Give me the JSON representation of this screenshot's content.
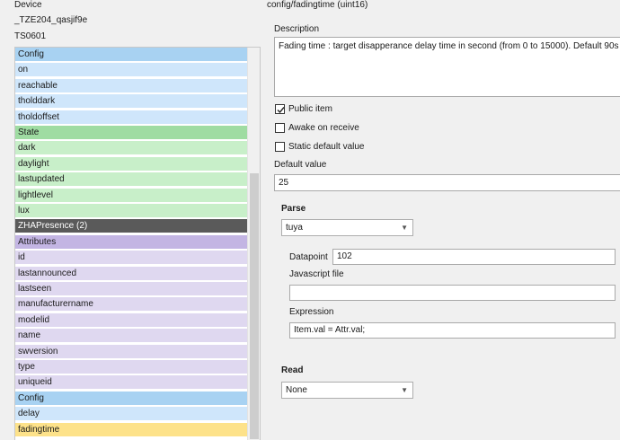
{
  "device": {
    "header_label": "Device",
    "model_id": "_TZE204_qasjif9e",
    "manufacturer": "TS0601"
  },
  "tree": {
    "rows": [
      {
        "label": "Config",
        "color": "#a8d2f2"
      },
      {
        "label": "on",
        "color": "#cfe6fb"
      },
      {
        "label": "reachable",
        "color": "#cfe6fb"
      },
      {
        "label": "tholddark",
        "color": "#cfe6fb"
      },
      {
        "label": "tholdoffset",
        "color": "#cfe6fb"
      },
      {
        "label": "State",
        "color": "#9fdca2"
      },
      {
        "label": "dark",
        "color": "#c8efc9"
      },
      {
        "label": "daylight",
        "color": "#c8efc9"
      },
      {
        "label": "lastupdated",
        "color": "#c8efc9"
      },
      {
        "label": "lightlevel",
        "color": "#c8efc9"
      },
      {
        "label": "lux",
        "color": "#c8efc9"
      },
      {
        "label": "ZHAPresence (2)",
        "color": "#5a5a5a",
        "text_color": "#ffffff"
      },
      {
        "label": "Attributes",
        "color": "#c3b5e3"
      },
      {
        "label": "id",
        "color": "#dfd8f0"
      },
      {
        "label": "lastannounced",
        "color": "#dfd8f0"
      },
      {
        "label": "lastseen",
        "color": "#dfd8f0"
      },
      {
        "label": "manufacturername",
        "color": "#dfd8f0"
      },
      {
        "label": "modelid",
        "color": "#dfd8f0"
      },
      {
        "label": "name",
        "color": "#dfd8f0"
      },
      {
        "label": "swversion",
        "color": "#dfd8f0"
      },
      {
        "label": "type",
        "color": "#dfd8f0"
      },
      {
        "label": "uniqueid",
        "color": "#dfd8f0"
      },
      {
        "label": "Config",
        "color": "#a8d2f2"
      },
      {
        "label": "delay",
        "color": "#cfe6fb"
      },
      {
        "label": "fadingtime",
        "color": "#fde28a"
      }
    ]
  },
  "detail": {
    "title": "config/fadingtime  (uint16)",
    "description_label": "Description",
    "description_text": "Fading time : target disapperance delay time in second (from 0 to 15000). Default 90s",
    "public_item_label": "Public item",
    "public_item_checked": true,
    "awake_on_receive_label": "Awake on receive",
    "awake_on_receive_checked": false,
    "static_default_label": "Static default value",
    "static_default_checked": false,
    "default_value_label": "Default value",
    "default_value": "25",
    "parse_label": "Parse",
    "parse_selected": "tuya",
    "datapoint_label": "Datapoint",
    "datapoint_value": "102",
    "js_file_label": "Javascript file",
    "js_file_value": "",
    "expression_label": "Expression",
    "expression_value": "Item.val = Attr.val;",
    "read_label": "Read",
    "read_selected": "None"
  }
}
